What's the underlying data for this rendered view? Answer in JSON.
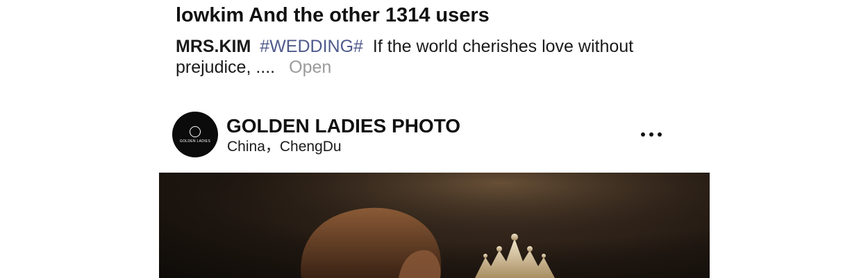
{
  "post_above": {
    "likes_text": "lowkim And the other 1314 users",
    "caption": {
      "author": "MRS.KIM",
      "hashtag": "#WEDDING#",
      "text_line1": "If the world cherishes love without",
      "text_line2": "prejudice, ....",
      "open_label": "Open"
    }
  },
  "post": {
    "account_name": "GOLDEN LADIES PHOTO",
    "location": "China，ChengDu",
    "avatar_text": "GOLDEN LADIES",
    "more_icon": "more-horizontal-icon"
  },
  "colors": {
    "hashtag": "#4f5a8c",
    "open_link": "#9a9a9a",
    "text": "#111111"
  }
}
